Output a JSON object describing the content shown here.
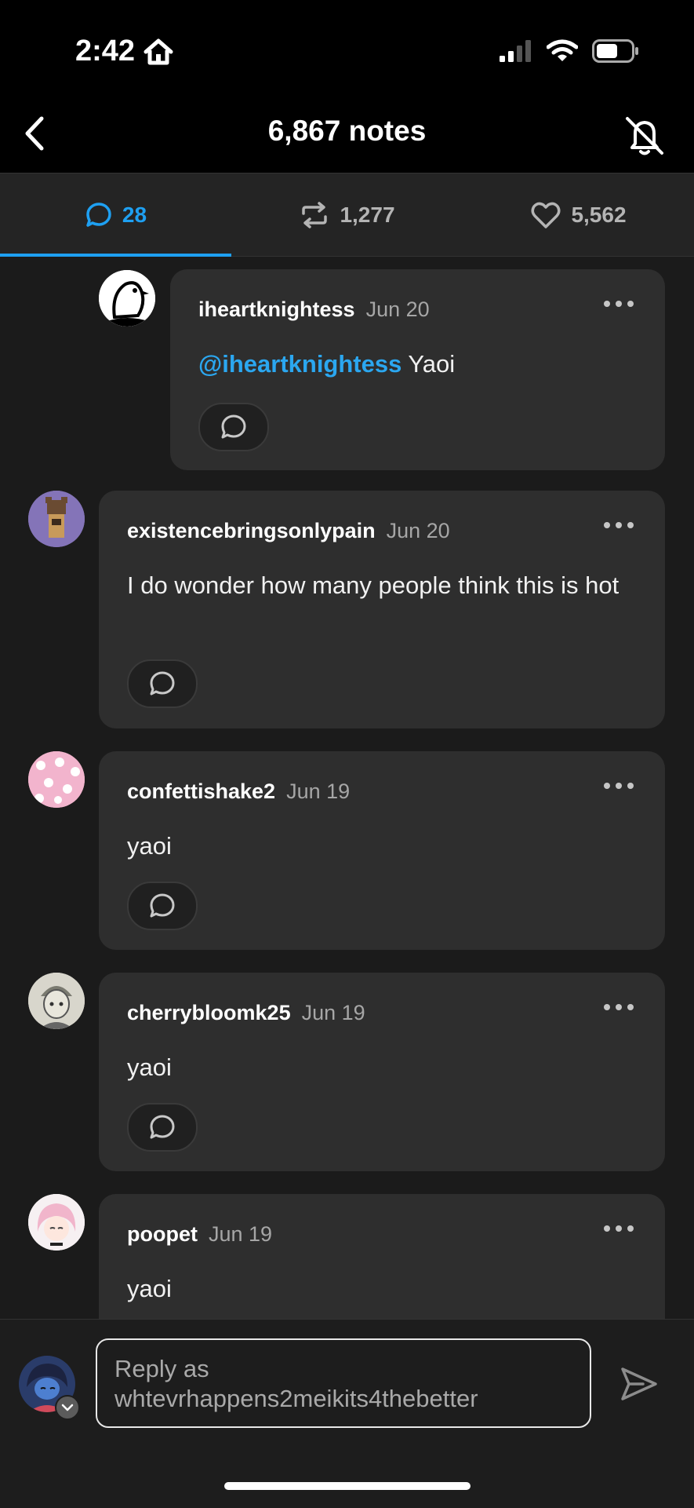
{
  "status_bar": {
    "time": "2:42"
  },
  "header": {
    "title": "6,867 notes"
  },
  "tabs": [
    {
      "label": "28",
      "icon": "comment-icon",
      "active": true
    },
    {
      "label": "1,277",
      "icon": "reblog-icon",
      "active": false
    },
    {
      "label": "5,562",
      "icon": "heart-icon",
      "active": false
    }
  ],
  "comments": [
    {
      "username": "iheartknightess",
      "date": "Jun 20",
      "mention": "@iheartknightess",
      "text": "Yaoi",
      "avatar": "bird-avatar"
    },
    {
      "username": "existencebringsonlypain",
      "date": "Jun 20",
      "text": "I do wonder how many people think this is hot",
      "avatar": "bear-avatar"
    },
    {
      "username": "confettishake2",
      "date": "Jun 19",
      "text": "yaoi",
      "avatar": "pink-dots-avatar"
    },
    {
      "username": "cherrybloomk25",
      "date": "Jun 19",
      "text": "yaoi",
      "avatar": "sketch-avatar"
    },
    {
      "username": "poopet",
      "date": "Jun 19",
      "text": "yaoi",
      "avatar": "anime-avatar"
    }
  ],
  "composer": {
    "reply_prefix": "Reply as",
    "reply_username": "whtevrhappens2meikits4thebetter"
  },
  "colors": {
    "accent": "#1ea0f2",
    "card": "#2e2e2e",
    "background": "#1b1b1b"
  }
}
